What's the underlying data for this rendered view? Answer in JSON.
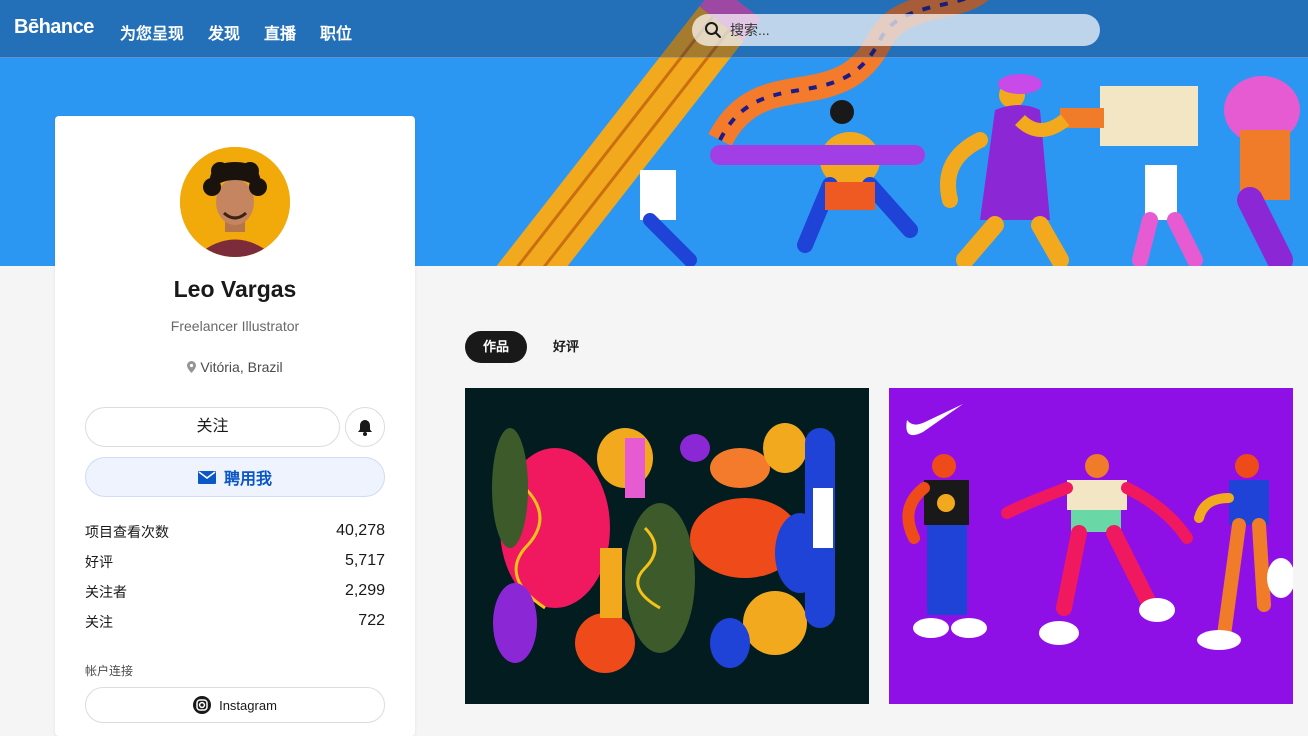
{
  "header": {
    "logo": "Bēhance",
    "nav": [
      "为您呈现",
      "发现",
      "直播",
      "职位"
    ],
    "search_placeholder": "搜索..."
  },
  "profile": {
    "name": "Leo Vargas",
    "occupation": "Freelancer Illustrator",
    "location": "Vitória, Brazil",
    "follow_label": "关注",
    "hire_label": "聘用我",
    "stats": [
      {
        "label": "项目查看次数",
        "value": "40,278"
      },
      {
        "label": "好评",
        "value": "5,717"
      },
      {
        "label": "关注者",
        "value": "2,299"
      },
      {
        "label": "关注",
        "value": "722"
      }
    ],
    "links_label": "帐户连接",
    "instagram_label": "Instagram"
  },
  "tabs": [
    {
      "label": "作品",
      "active": true
    },
    {
      "label": "好评",
      "active": false
    }
  ],
  "colors": {
    "banner": "#2c97f2",
    "accent_blue": "#0a57c7",
    "project1_bg": "#031c20",
    "project2_bg": "#8f10e6"
  }
}
